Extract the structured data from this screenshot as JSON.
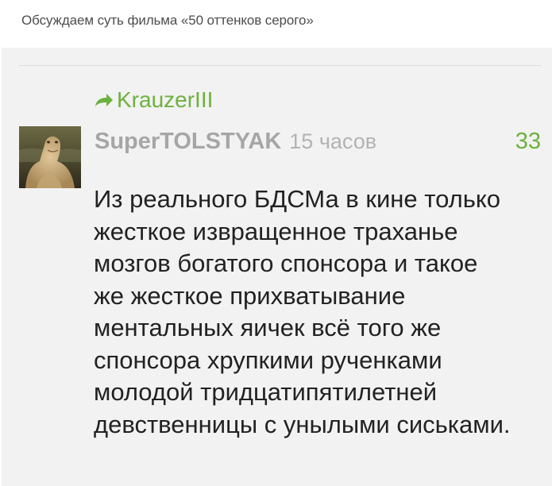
{
  "topic": {
    "title": "Обсуждаем суть фильма «50 оттенков серого»"
  },
  "comment": {
    "reply_to": "KrauzerIII",
    "author": "SuperTOLSTYAK",
    "time_ago": "15 часов",
    "rating": "33",
    "text_lines": [
      "Из реального БДСМа в кине только",
      "жесткое извращенное траханье",
      "мозгов богатого спонсора и такое",
      "же жесткое прихватывание",
      "ментальных яичек всё того же",
      "спонсора хрупкими рученками",
      "молодой тридцатипятилетней",
      "девственницы с унылыми сиськами."
    ]
  },
  "colors": {
    "accent_green": "#6db13f",
    "meta_gray": "#a6a6a6",
    "panel_bg": "#f2f2f2",
    "text_dark": "#222222"
  },
  "icons": {
    "reply": "reply-arrow-icon"
  }
}
